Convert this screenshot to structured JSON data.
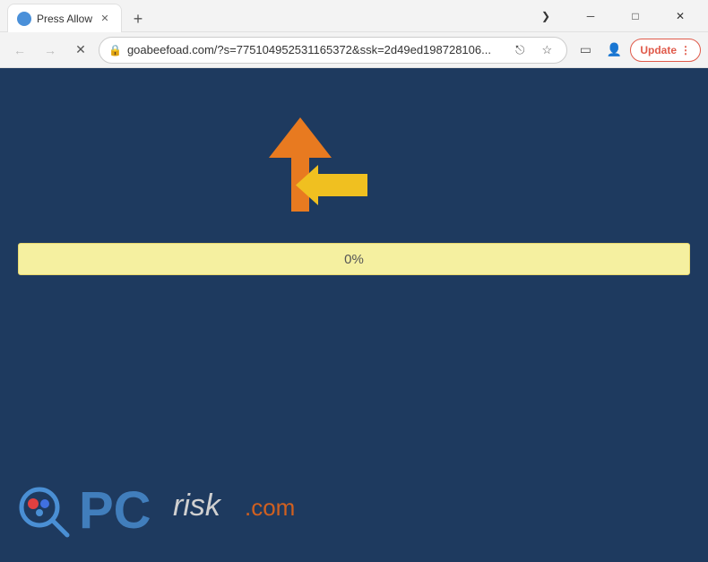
{
  "titlebar": {
    "tab": {
      "title": "Press Allow",
      "favicon": "browser-favicon"
    },
    "new_tab_label": "+",
    "window_controls": {
      "chevron": "❮",
      "minimize": "─",
      "maximize": "□",
      "close": "✕"
    }
  },
  "addressbar": {
    "back_label": "←",
    "forward_label": "→",
    "reload_label": "✕",
    "url": "goabeefoad.com/?s=775104952531165372&ssk=2d49ed198728106...",
    "lock_icon": "🔒",
    "share_icon": "⎋",
    "bookmark_icon": "☆",
    "sidebar_icon": "▭",
    "profile_icon": "👤",
    "update_label": "Update",
    "update_chevron": "⋮"
  },
  "content": {
    "progress": {
      "label": "0%"
    },
    "arrows": {
      "orange": "orange arrow pointing upper-right",
      "yellow": "yellow arrow pointing left"
    }
  },
  "logo": {
    "pc": "PC",
    "risk": "risk",
    "dotcom": ".com"
  }
}
